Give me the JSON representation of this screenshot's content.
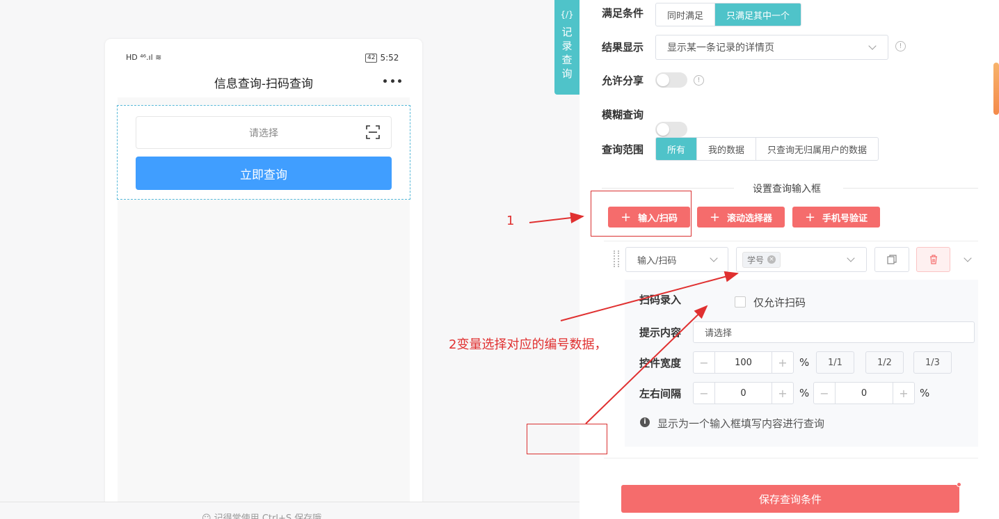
{
  "phone": {
    "status_left": "HD ⁴⁶.ıl ≋",
    "battery": "42",
    "time": "5:52",
    "title": "信息查询-扫码查询",
    "input_placeholder": "请选择",
    "query_button": "立即查询"
  },
  "footer_hint": "☺ 记得常使用 Ctrl+S 保存哦",
  "side_tab": {
    "icon": "{/}",
    "label": "记录查询"
  },
  "settings": {
    "condition_label": "满足条件",
    "condition_options": [
      "同时满足",
      "只满足其中一个"
    ],
    "result_label": "结果显示",
    "result_value": "显示某一条记录的详情页",
    "share_label": "允许分享",
    "fuzzy_label": "模糊查询",
    "scope_label": "查询范围",
    "scope_options": [
      "所有",
      "我的数据",
      "只查询无归属用户的数据"
    ]
  },
  "input_section": {
    "title": "设置查询输入框",
    "add_buttons": [
      "输入/扫码",
      "滚动选择器",
      "手机号验证"
    ],
    "type_value": "输入/扫码",
    "variable_tag": "学号",
    "scan_label": "扫码录入",
    "scan_only_label": "仅允许扫码",
    "hint_label": "提示内容",
    "hint_value": "请选择",
    "width_label": "控件宽度",
    "width_value": "100",
    "width_unit": "%",
    "width_presets": [
      "1/1",
      "1/2",
      "1/3"
    ],
    "gap_label": "左右间隔",
    "gap_left": "0",
    "gap_right": "0",
    "gap_unit": "%",
    "info_text": "显示为一个输入框填写内容进行查询"
  },
  "save_button": "保存查询条件",
  "annotations": {
    "step1": "1",
    "step2": "2变量选择对应的编号数据，"
  },
  "colors": {
    "accent": "#4fc3c9",
    "primary": "#409eff",
    "danger": "#f56c6c",
    "annotation": "#e03030"
  }
}
